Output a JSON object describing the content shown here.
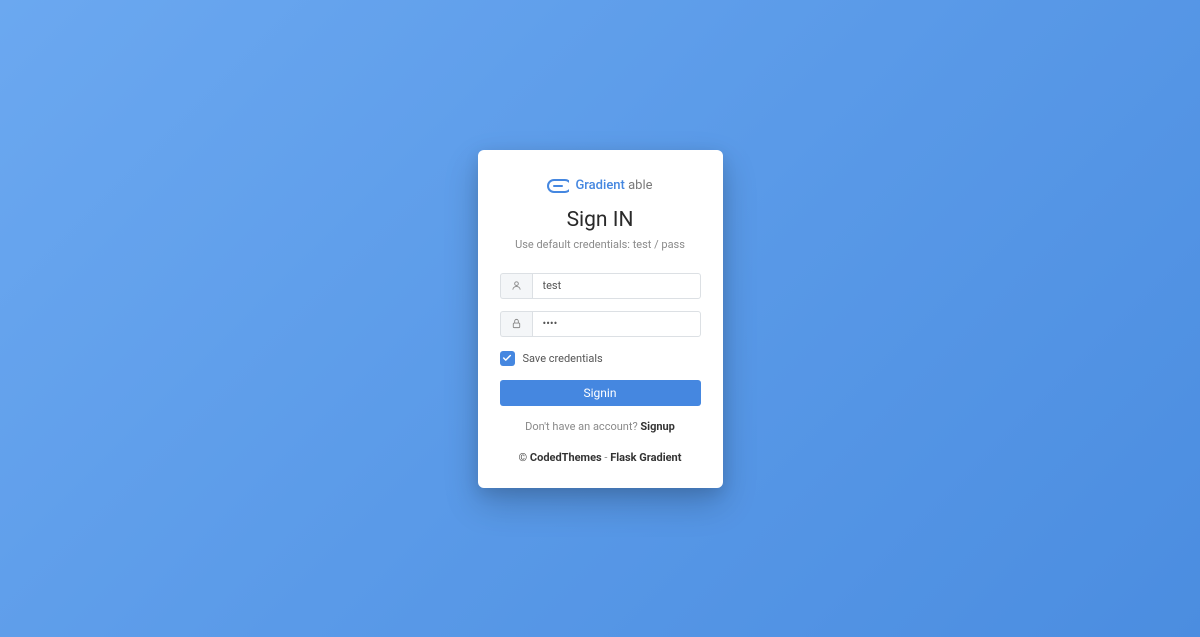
{
  "logo": {
    "brand": "Gradient",
    "suffix": "able"
  },
  "title": "Sign IN",
  "subtitle": "Use default credentials: test / pass",
  "form": {
    "username": {
      "value": "test",
      "placeholder": ""
    },
    "password": {
      "value": "••••",
      "placeholder": ""
    },
    "save_credentials_label": "Save credentials",
    "save_credentials_checked": true,
    "submit_label": "Signin"
  },
  "signup": {
    "prompt": "Don't have an account? ",
    "link": "Signup"
  },
  "footer": {
    "copyright": "© ",
    "link1": "CodedThemes",
    "sep": " - ",
    "link2": "Flask Gradient"
  },
  "colors": {
    "accent": "#4587e0"
  }
}
